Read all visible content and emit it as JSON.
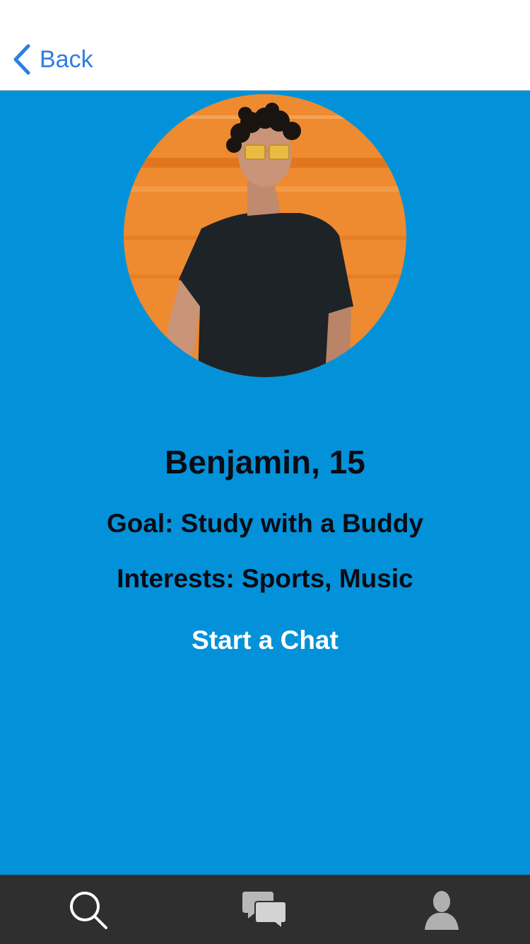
{
  "navbar": {
    "back_label": "Back",
    "back_icon": "chevron-left-icon"
  },
  "profile": {
    "name": "Benjamin, 15",
    "goal": "Goal: Study with a Buddy",
    "interests": "Interests: Sports, Music",
    "start_chat_label": "Start a Chat"
  },
  "tabbar": {
    "tabs": [
      {
        "icon": "search-icon"
      },
      {
        "icon": "chat-bubbles-icon"
      },
      {
        "icon": "person-icon"
      }
    ]
  },
  "colors": {
    "accent": "#2f7ee0",
    "content_background": "#0392d9",
    "tabbar_background": "#2f2f2f",
    "text_dark": "#0b0b14"
  }
}
